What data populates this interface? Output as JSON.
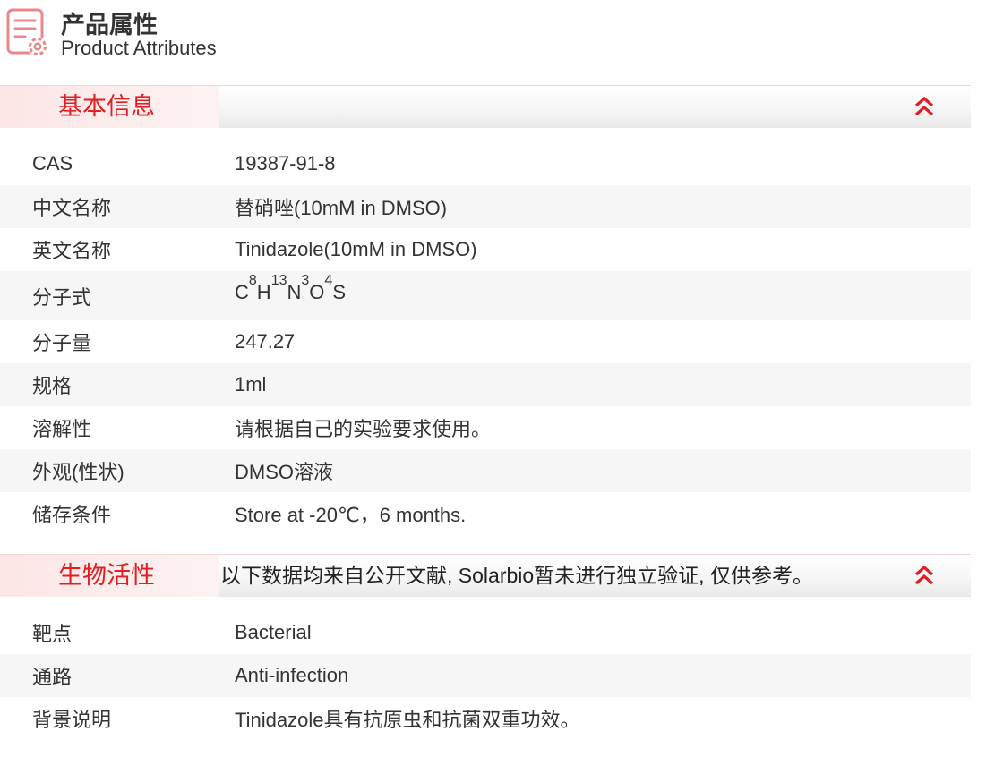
{
  "header": {
    "title": "产品属性",
    "subtitle": "Product Attributes",
    "icon": "document-settings-icon",
    "accent_color": "#e01e24"
  },
  "basic_info": {
    "title": "基本信息",
    "toggle_icon": "double-chevron-up-icon",
    "rows": {
      "cas": {
        "label": "CAS",
        "value": "19387-91-8"
      },
      "cn_name": {
        "label": "中文名称",
        "value": "替硝唑(10mM in DMSO)"
      },
      "en_name": {
        "label": "英文名称",
        "value": "Tinidazole(10mM in DMSO)"
      },
      "formula": {
        "label": "分子式",
        "parts": {
          "c": "C",
          "c_n": "8",
          "h": "H",
          "h_n": "13",
          "n": "N",
          "n_n": "3",
          "o": "O",
          "o_n": "4",
          "s": "S"
        }
      },
      "mw": {
        "label": "分子量",
        "value": "247.27"
      },
      "spec": {
        "label": "规格",
        "value": "1ml"
      },
      "solubility": {
        "label": "溶解性",
        "value": "请根据自己的实验要求使用。"
      },
      "appearance": {
        "label": "外观(性状)",
        "value": "DMSO溶液"
      },
      "storage": {
        "label": "储存条件",
        "value": "Store at -20℃，6 months."
      }
    }
  },
  "bio_activity": {
    "title": "生物活性",
    "note": "以下数据均来自公开文献, Solarbio暂未进行独立验证, 仅供参考。",
    "toggle_icon": "double-chevron-up-icon",
    "rows": {
      "target": {
        "label": "靶点",
        "value": "Bacterial"
      },
      "pathway": {
        "label": "通路",
        "value": "Anti-infection"
      },
      "background": {
        "label": "背景说明",
        "value": "Tinidazole具有抗原虫和抗菌双重功效。"
      }
    }
  }
}
